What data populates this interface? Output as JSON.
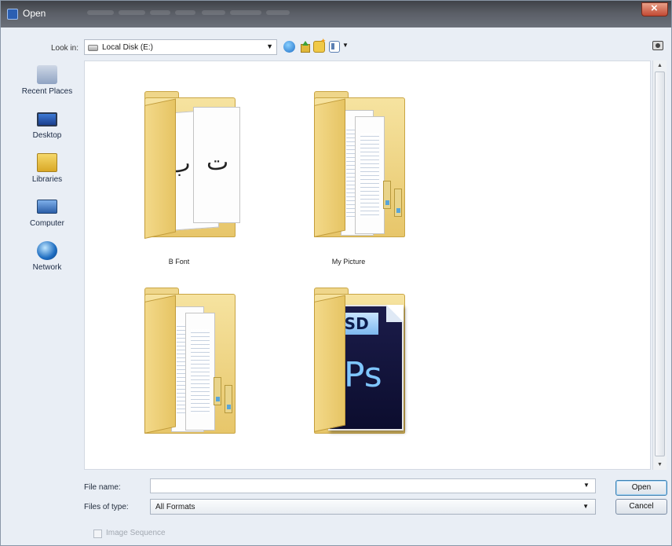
{
  "window": {
    "title": "Open"
  },
  "toolbar": {
    "look_in_label": "Look in:",
    "look_in_value": "Local Disk (E:)",
    "icons": [
      "back-icon",
      "up-folder-icon",
      "new-folder-icon",
      "view-menu-icon",
      "camera-icon"
    ]
  },
  "places": [
    {
      "label": "Recent Places",
      "icon": "recent-places-icon"
    },
    {
      "label": "Desktop",
      "icon": "desktop-icon"
    },
    {
      "label": "Libraries",
      "icon": "libraries-icon"
    },
    {
      "label": "Computer",
      "icon": "computer-icon"
    },
    {
      "label": "Network",
      "icon": "network-icon"
    }
  ],
  "items": [
    {
      "label": "B Font",
      "type": "folder"
    },
    {
      "label": "My Picture",
      "type": "folder"
    },
    {
      "label": "",
      "type": "folder"
    },
    {
      "label": "",
      "type": "psd-file"
    }
  ],
  "psd_icon": {
    "badge": "PSD",
    "mark": "Ps"
  },
  "font_glyphs": [
    "أ ب",
    "ت"
  ],
  "form": {
    "file_name_label": "File name:",
    "file_name_value": "",
    "files_of_type_label": "Files of type:",
    "files_of_type_value": "All Formats",
    "open_label": "Open",
    "cancel_label": "Cancel",
    "image_sequence_label": "Image Sequence"
  }
}
